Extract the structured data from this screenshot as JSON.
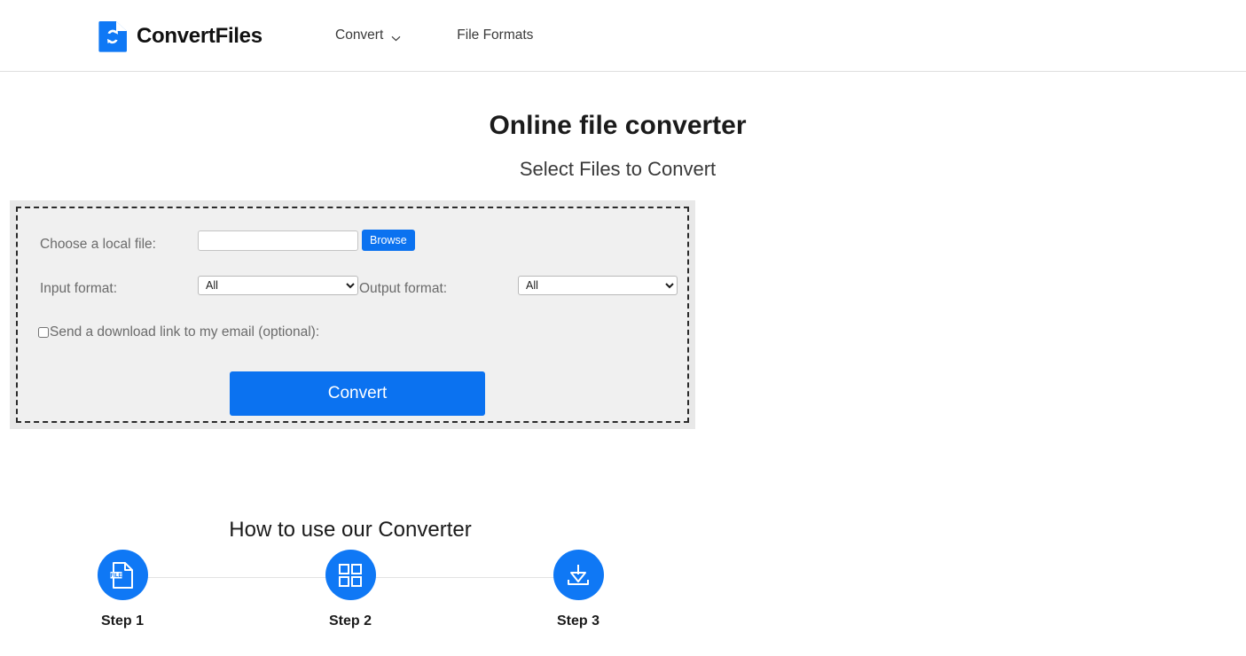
{
  "header": {
    "brand_name": "ConvertFiles",
    "brand_icon": "file-convert-logo-icon",
    "nav": [
      {
        "label": "Convert",
        "icon": "chevron-down-icon",
        "has_dropdown": true
      },
      {
        "label": "File Formats",
        "has_dropdown": false
      }
    ]
  },
  "hero": {
    "title": "Online file converter",
    "subtitle": "Select Files to Convert"
  },
  "converter": {
    "file_label": "Choose a local file:",
    "file_value": "",
    "file_placeholder": "",
    "browse_label": "Browse",
    "input_format_label": "Input format:",
    "input_format_value": "All",
    "input_format_options": [
      "All"
    ],
    "output_format_label": "Output format:",
    "output_format_value": "All",
    "output_format_options": [
      "All"
    ],
    "email_label": "Send a download link to my email (optional):",
    "email_checked": false,
    "convert_label": "Convert"
  },
  "howto": {
    "title": "How to use our Converter",
    "steps": [
      {
        "label": "Step 1",
        "icon": "file-document-icon"
      },
      {
        "label": "Step 2",
        "icon": "grid-four-squares-icon"
      },
      {
        "label": "Step 3",
        "icon": "download-tray-icon"
      }
    ]
  },
  "colors": {
    "accent_blue": "#0b72f0",
    "step_blue": "#0f78f5",
    "panel_gray": "#f0f0f0",
    "panel_outer_gray": "#e8e8e8",
    "label_gray": "#6b6b6b",
    "header_border": "#dfdfdf"
  }
}
